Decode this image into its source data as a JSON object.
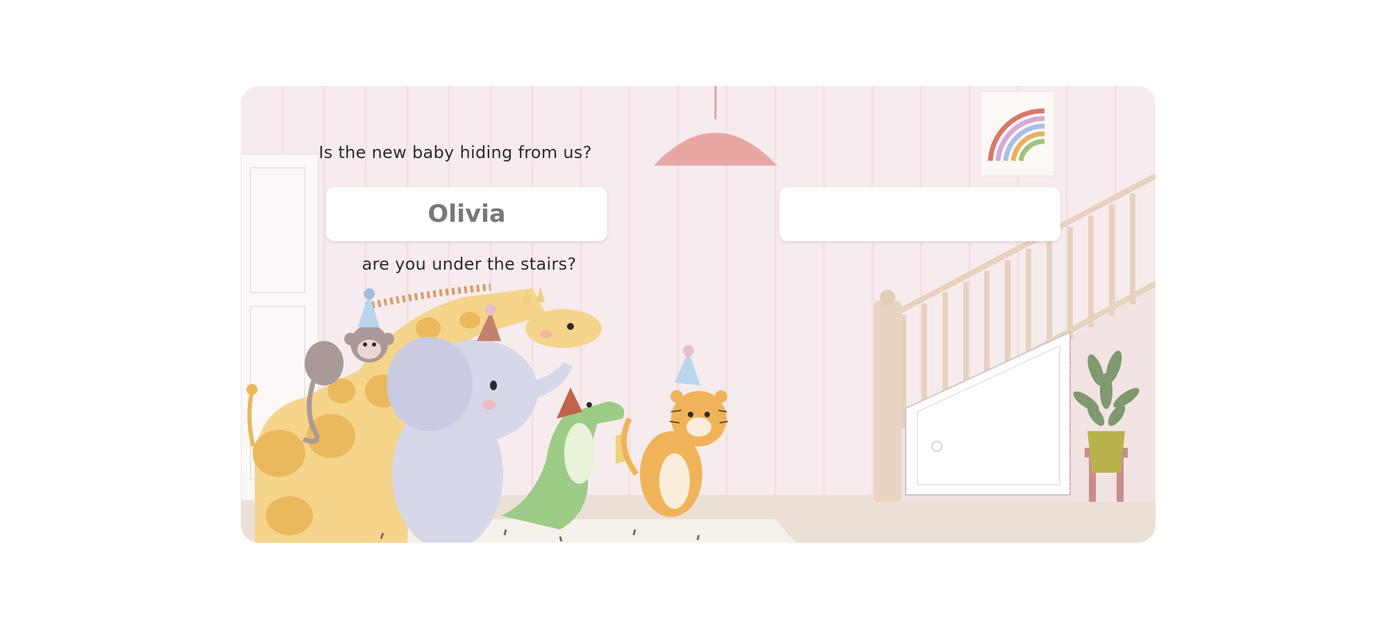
{
  "story": {
    "line_top": "Is the new baby hiding from us?",
    "line_bottom": "are you under the stairs?"
  },
  "personalization": {
    "child_name": "Olivia",
    "second_name": ""
  },
  "colors": {
    "wall": "#f7eced",
    "floor": "#ebe0d6",
    "lamp": "#e8a7a2",
    "stairs": "#e8d4bf",
    "giraffe": "#f5d58c",
    "giraffe_spots": "#e9b95c",
    "elephant": "#d6d8ea",
    "crocodile": "#9ccc86",
    "tiger": "#f0b35a",
    "monkey": "#a99a98",
    "plant": "#7f9a6e",
    "pot": "#b9b24c",
    "stand": "#c98c8a"
  },
  "icons": [
    "lamp-icon",
    "rainbow-picture-icon",
    "giraffe-icon",
    "monkey-icon",
    "elephant-icon",
    "crocodile-icon",
    "tiger-icon",
    "potted-plant-icon",
    "staircase-icon",
    "under-stairs-door-icon"
  ]
}
